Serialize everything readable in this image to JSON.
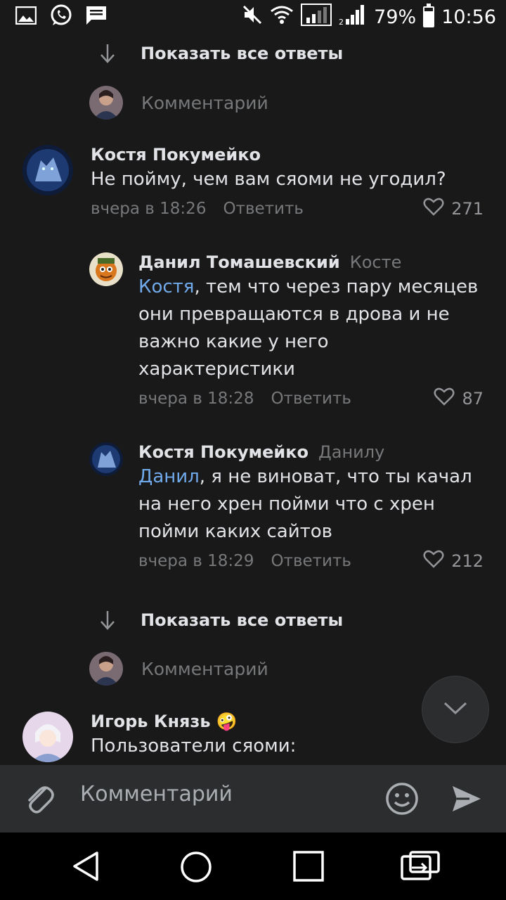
{
  "status_bar": {
    "left_icons": [
      "image-icon",
      "whatsapp-icon",
      "message-icon"
    ],
    "right_icons": [
      "mute-icon",
      "wifi-icon",
      "signal-sim1-icon",
      "signal-sim2-icon"
    ],
    "battery_percent": "79%",
    "battery_level": 0.79,
    "time": "10:56"
  },
  "feed": {
    "show_all_top": "Показать все ответы",
    "reply_placeholder_top": "Комментарий",
    "comments": [
      {
        "author": "Костя Покумейко",
        "text": "Не пойму, чем вам сяоми не угодил?",
        "time": "вчера в 18:26",
        "reply_label": "Ответить",
        "likes": "271"
      }
    ],
    "replies": [
      {
        "author": "Данил Томашевский",
        "reply_to": "Косте",
        "mention": "Костя",
        "text": ", тем что через пару месяцев они превращаются в дрова и не важно какие у него характеристики",
        "time": "вчера в 18:28",
        "reply_label": "Ответить",
        "likes": "87"
      },
      {
        "author": "Костя Покумейко",
        "reply_to": "Данилу",
        "mention": "Данил",
        "text": ", я не виноват, что ты качал на него хрен пойми что с хрен пойми каких сайтов",
        "time": "вчера в 18:29",
        "reply_label": "Ответить",
        "likes": "212"
      }
    ],
    "show_all_bottom": "Показать все ответы",
    "reply_placeholder_bottom": "Комментарий",
    "last_comment": {
      "author": "Игорь Князь",
      "emoji": "🤪",
      "text": "Пользователи сяоми:"
    }
  },
  "composer": {
    "placeholder": "Комментарий"
  },
  "colors": {
    "background": "#19191a",
    "mention": "#71aaeb",
    "secondary_text": "#76787a",
    "composer_bg": "#2c2d2e"
  }
}
